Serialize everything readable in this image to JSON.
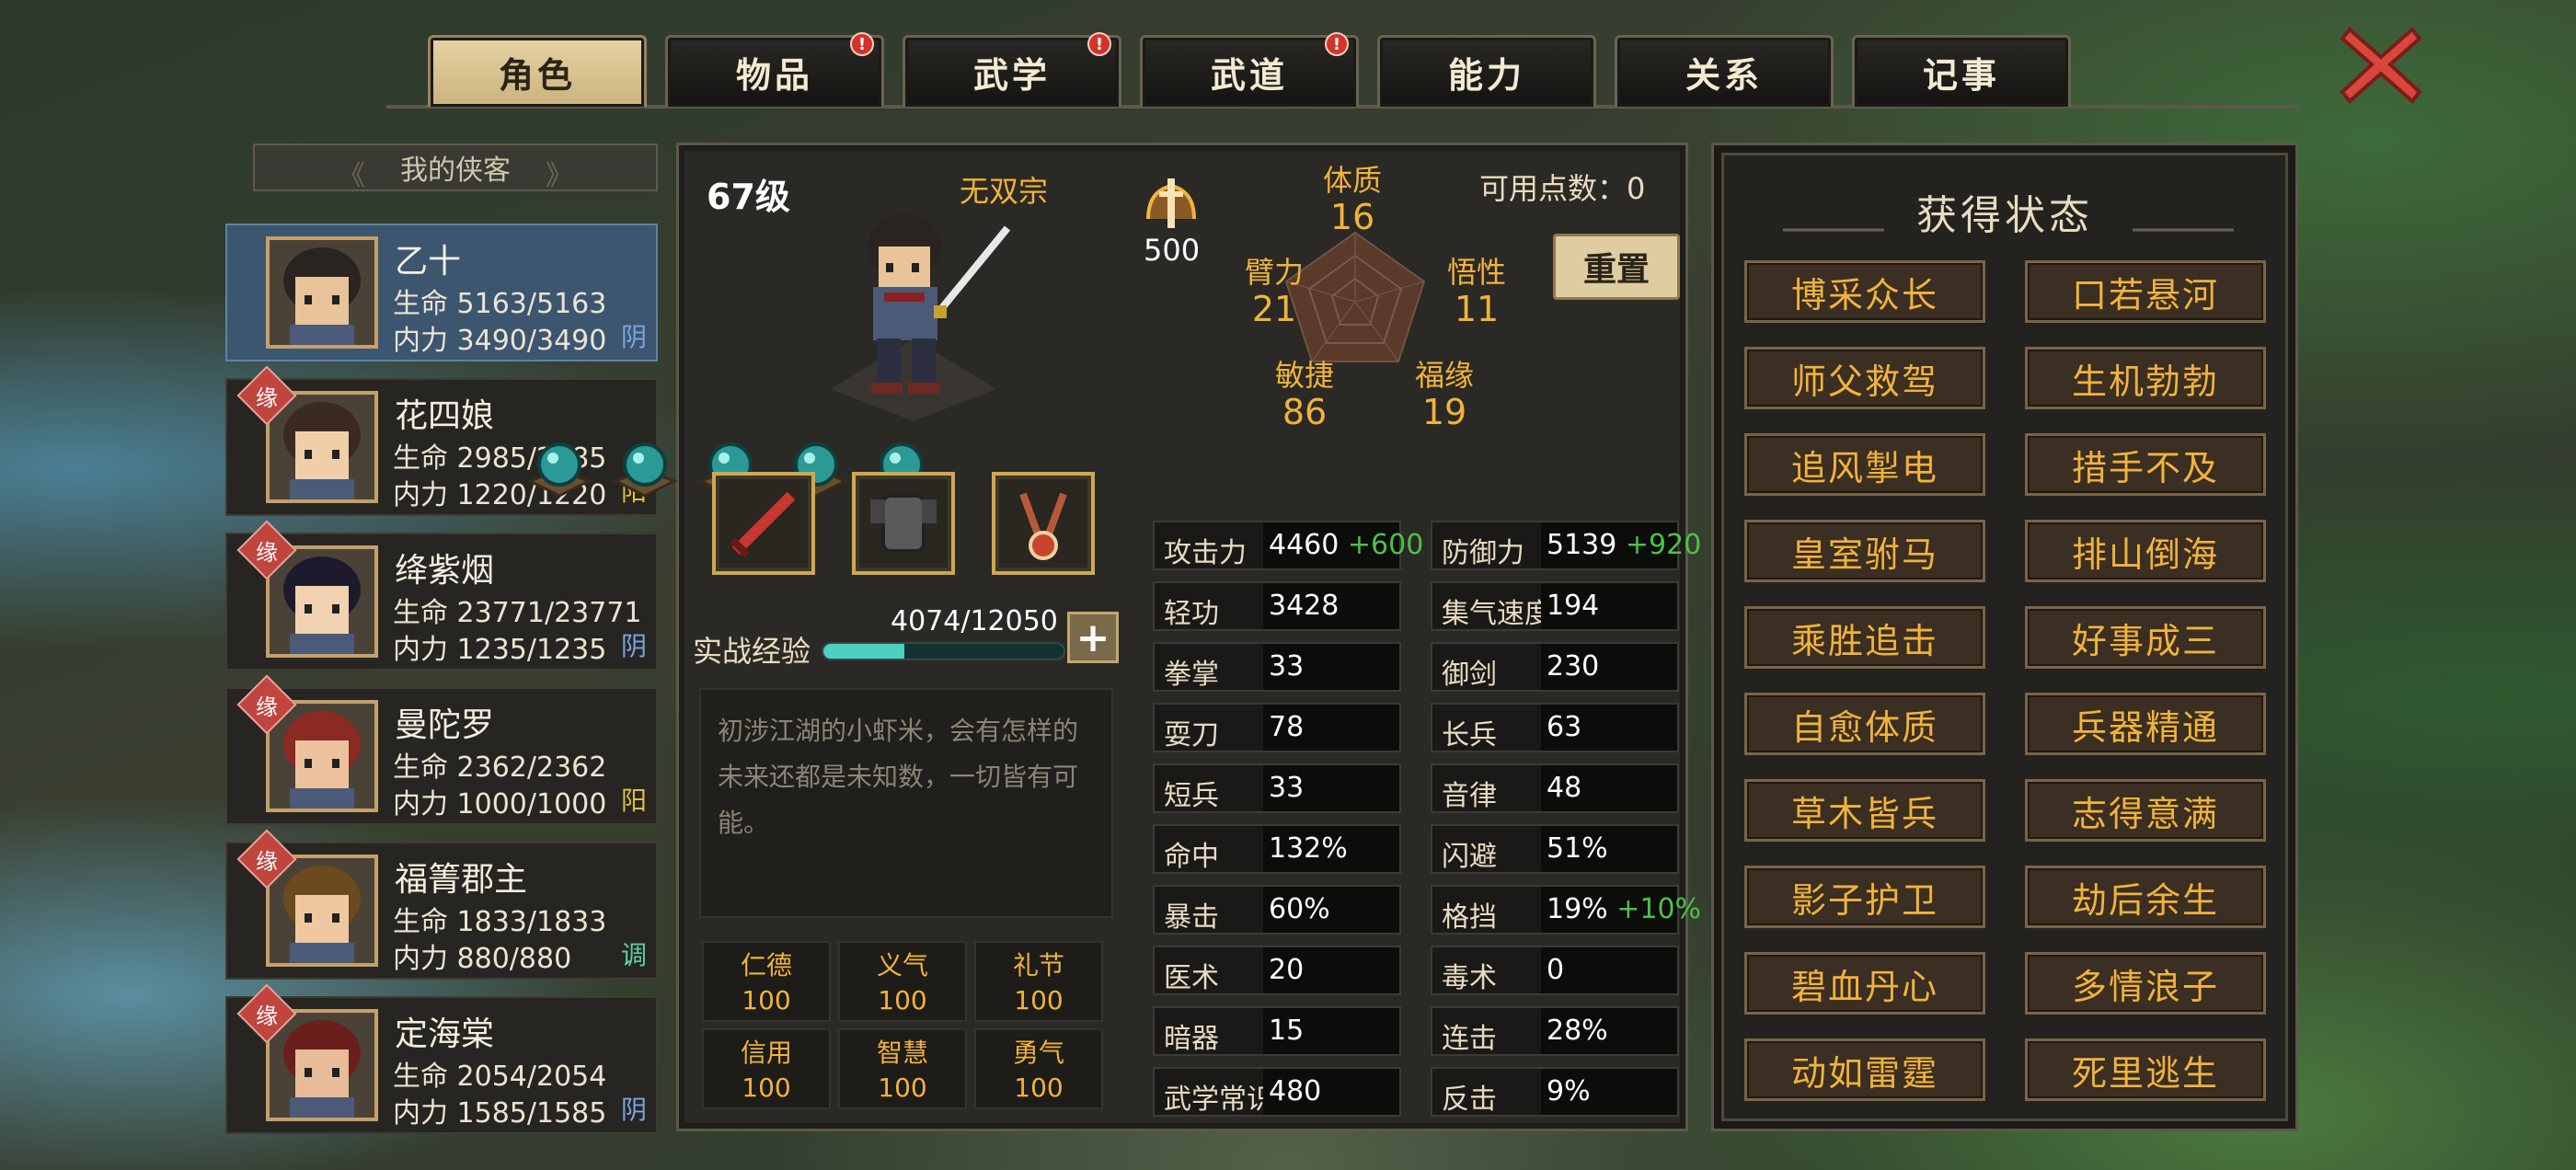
{
  "tabs": [
    {
      "label": "角色",
      "active": true,
      "badge": ""
    },
    {
      "label": "物品",
      "active": false,
      "badge": "!"
    },
    {
      "label": "武学",
      "active": false,
      "badge": "!"
    },
    {
      "label": "武道",
      "active": false,
      "badge": "!"
    },
    {
      "label": "能力",
      "active": false,
      "badge": ""
    },
    {
      "label": "关系",
      "active": false,
      "badge": ""
    },
    {
      "label": "记事",
      "active": false,
      "badge": ""
    }
  ],
  "close_icon": "close-x-icon",
  "roster": {
    "label": "我的侠客",
    "heroes": [
      {
        "name": "乙十",
        "hp": "生命 5163/5163",
        "mp": "内力 3490/3490",
        "tag": "阴",
        "tag_color": "#7aa6e0",
        "fate": "",
        "active": true
      },
      {
        "name": "花四娘",
        "hp": "生命 2985/2985",
        "mp": "内力 1220/1220",
        "tag": "阳",
        "tag_color": "#e0c040",
        "fate": "缘",
        "active": false
      },
      {
        "name": "绛紫烟",
        "hp": "生命 23771/23771",
        "mp": "内力 1235/1235",
        "tag": "阴",
        "tag_color": "#7aa6e0",
        "fate": "缘",
        "active": false
      },
      {
        "name": "曼陀罗",
        "hp": "生命 2362/2362",
        "mp": "内力 1000/1000",
        "tag": "阳",
        "tag_color": "#e0c040",
        "fate": "缘",
        "active": false
      },
      {
        "name": "福箐郡主",
        "hp": "生命 1833/1833",
        "mp": "内力 880/880",
        "tag": "调",
        "tag_color": "#5fd0a0",
        "fate": "缘",
        "active": false
      },
      {
        "name": "定海棠",
        "hp": "生命 2054/2054",
        "mp": "内力 1585/1585",
        "tag": "阴",
        "tag_color": "#7aa6e0",
        "fate": "缘",
        "active": false
      }
    ]
  },
  "character": {
    "level": "67级",
    "sect": "无双宗",
    "score": "500",
    "points_label": "可用点数：0",
    "reset_label": "重置",
    "radar": [
      {
        "label": "体质",
        "value": "16"
      },
      {
        "label": "悟性",
        "value": "11"
      },
      {
        "label": "福缘",
        "value": "19"
      },
      {
        "label": "敏捷",
        "value": "86"
      },
      {
        "label": "臂力",
        "value": "21"
      }
    ],
    "exp_label": "实战经验",
    "exp_text": "4074/12050",
    "exp_ratio": 0.338,
    "plus_label": "+",
    "description": "初涉江湖的小虾米，会有怎样的未来还都是未知数，一切皆有可能。",
    "virtues": [
      {
        "name": "仁德",
        "value": "100"
      },
      {
        "name": "义气",
        "value": "100"
      },
      {
        "name": "礼节",
        "value": "100"
      },
      {
        "name": "信用",
        "value": "100"
      },
      {
        "name": "智慧",
        "value": "100"
      },
      {
        "name": "勇气",
        "value": "100"
      }
    ]
  },
  "stats": [
    {
      "label": "攻击力",
      "value": "4460",
      "bonus": "+600"
    },
    {
      "label": "防御力",
      "value": "5139",
      "bonus": "+920"
    },
    {
      "label": "轻功",
      "value": "3428",
      "bonus": ""
    },
    {
      "label": "集气速度",
      "value": "194",
      "bonus": ""
    },
    {
      "label": "拳掌",
      "value": "33",
      "bonus": ""
    },
    {
      "label": "御剑",
      "value": "230",
      "bonus": ""
    },
    {
      "label": "耍刀",
      "value": "78",
      "bonus": ""
    },
    {
      "label": "长兵",
      "value": "63",
      "bonus": ""
    },
    {
      "label": "短兵",
      "value": "33",
      "bonus": ""
    },
    {
      "label": "音律",
      "value": "48",
      "bonus": ""
    },
    {
      "label": "命中",
      "value": "132%",
      "bonus": ""
    },
    {
      "label": "闪避",
      "value": "51%",
      "bonus": ""
    },
    {
      "label": "暴击",
      "value": "60%",
      "bonus": ""
    },
    {
      "label": "格挡",
      "value": "19%",
      "bonus": "+10%"
    },
    {
      "label": "医术",
      "value": "20",
      "bonus": ""
    },
    {
      "label": "毒术",
      "value": "0",
      "bonus": ""
    },
    {
      "label": "暗器",
      "value": "15",
      "bonus": ""
    },
    {
      "label": "连击",
      "value": "28%",
      "bonus": ""
    },
    {
      "label": "武学常识",
      "value": "480",
      "bonus": ""
    },
    {
      "label": "反击",
      "value": "9%",
      "bonus": ""
    }
  ],
  "status_panel": {
    "title": "获得状态",
    "items": [
      "博采众长",
      "口若悬河",
      "师父救驾",
      "生机勃勃",
      "追风掣电",
      "措手不及",
      "皇室驸马",
      "排山倒海",
      "乘胜追击",
      "好事成三",
      "自愈体质",
      "兵器精通",
      "草木皆兵",
      "志得意满",
      "影子护卫",
      "劫后余生",
      "碧血丹心",
      "多情浪子",
      "动如雷霆",
      "死里逃生"
    ]
  },
  "colors": {
    "accent_gold": "#f0b33c",
    "bonus_green": "#4ac247",
    "exp_teal": "#4ed0c1"
  }
}
